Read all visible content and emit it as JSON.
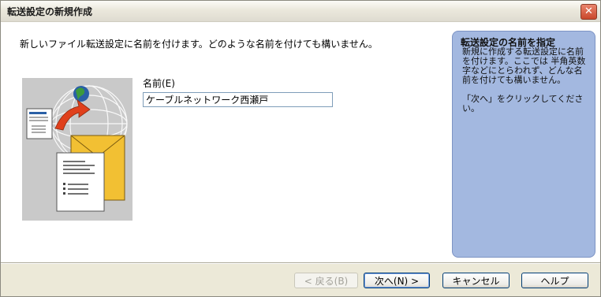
{
  "window": {
    "title": "転送設定の新規作成",
    "close_glyph": "✕"
  },
  "main": {
    "instruction": "新しいファイル転送設定に名前を付けます。どのような名前を付けても構いません。",
    "name_label": "名前(E)",
    "name_value": "ケーブルネットワーク西瀬戸"
  },
  "help": {
    "title": "転送設定の名前を指定",
    "body1": "新規に作成する転送設定に名前を付けます。ここでは 半角英数字などにとらわれず、どんな名前を付けても構いません。",
    "body2": "「次へ」をクリックしてください。"
  },
  "buttons": {
    "back": "< 戻る(B)",
    "next": "次へ(N) >",
    "cancel": "キャンセル",
    "help": "ヘルプ"
  },
  "colors": {
    "help_pane": "#a3b8e0",
    "accent_arrow": "#e0401c",
    "envelope": "#f2c033"
  }
}
